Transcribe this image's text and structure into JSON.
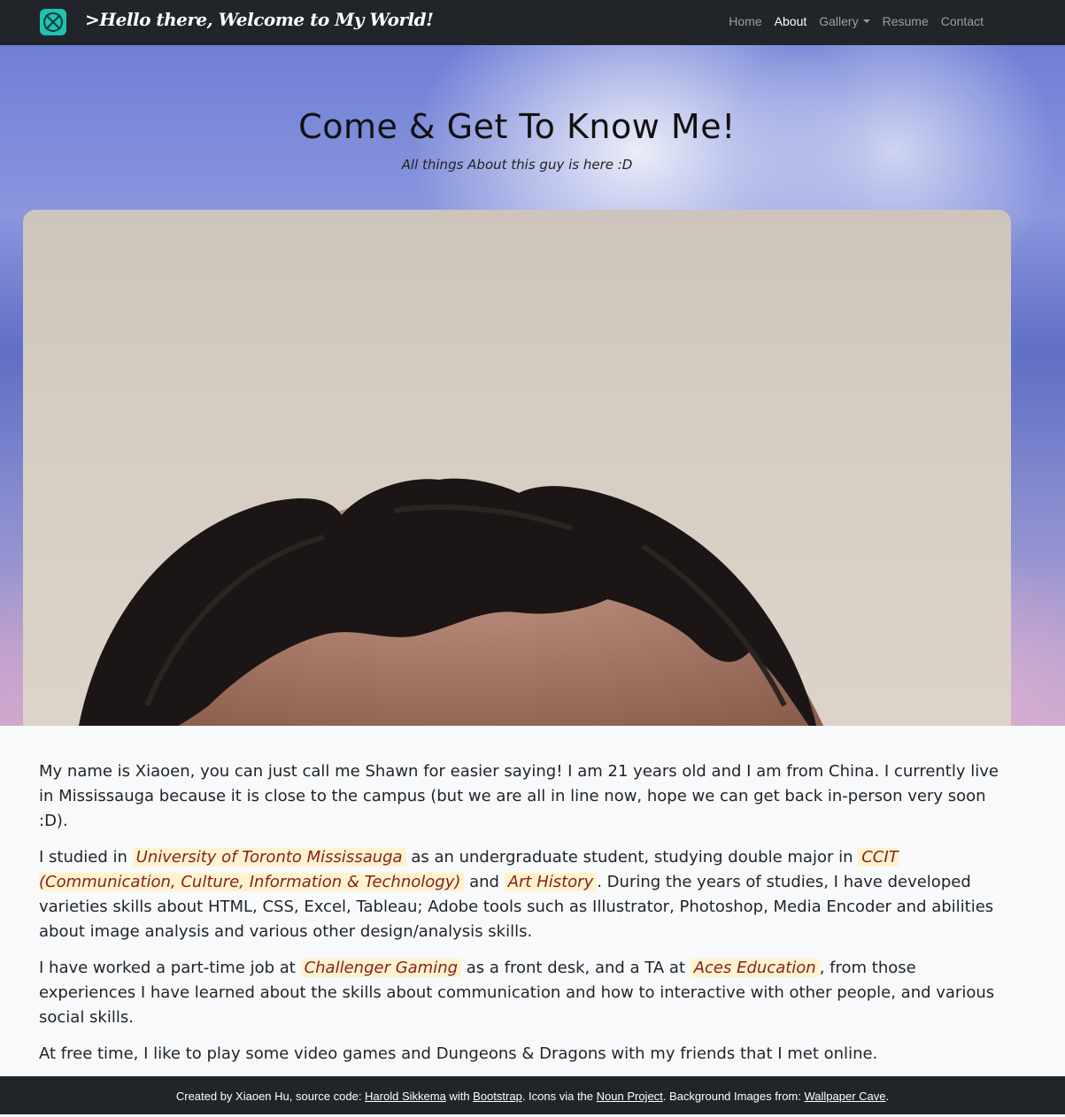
{
  "navbar": {
    "brand_text": ">Hello there, Welcome to My World!",
    "links": [
      "Home",
      "About",
      "Gallery",
      "Resume",
      "Contact"
    ],
    "active": "About"
  },
  "hero": {
    "title": "Come & Get To Know Me!",
    "subtitle": "All things About this guy is here :D"
  },
  "content": {
    "p1": "My name is Xiaoen, you can just call me Shawn for easier saying! I am 21 years old and I am from China. I currently live in Mississauga because it is close to the campus (but we are all in line now, hope we can get back in-person very soon :D).",
    "p2_a": "I studied in ",
    "p2_hl1": "University of Toronto Mississauga",
    "p2_b": " as an undergraduate student, studying double major in ",
    "p2_hl2": "CCIT (Communication, Culture, Information & Technology)",
    "p2_c": " and ",
    "p2_hl3": "Art History",
    "p2_d": ". During the years of studies, I have developed varieties skills about HTML, CSS, Excel, Tableau; Adobe tools such as Illustrator, Photoshop, Media Encoder and abilities about image analysis and various other design/analysis skills.",
    "p3_a": "I have worked a part-time job at ",
    "p3_hl1": "Challenger Gaming",
    "p3_b": " as a front desk, and a TA at ",
    "p3_hl2": "Aces Education",
    "p3_c": ", from those experiences I have learned about the skills about communication and how to interactive with other people, and various social skills.",
    "p4": "At free time, I like to play some video games and Dungeons & Dragons with my friends that I met online."
  },
  "footer": {
    "t1": "Created by Xiaoen Hu, source code: ",
    "l1": "Harold Sikkema",
    "t2": " with ",
    "l2": "Bootstrap",
    "t3": ". Icons via the ",
    "l3": "Noun Project",
    "t4": ". Background Images from: ",
    "l4": "Wallpaper Cave",
    "t5": "."
  },
  "colors": {
    "navbar_bg": "#212529",
    "logo": "#1fc2b3",
    "highlight_bg": "#fff3cd",
    "highlight_text": "#842029"
  }
}
